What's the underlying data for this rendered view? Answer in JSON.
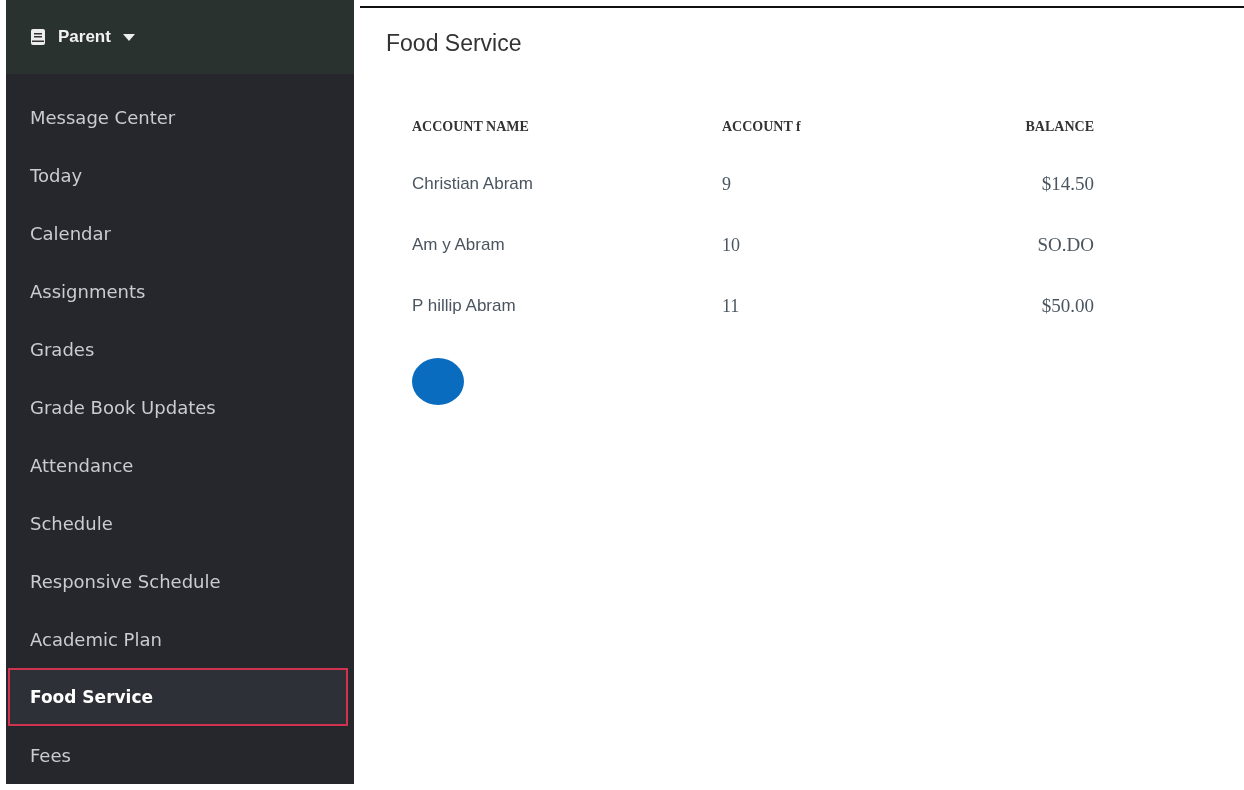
{
  "sidebar": {
    "header": {
      "label": "Parent"
    },
    "items": [
      {
        "label": "Message Center",
        "selected": false
      },
      {
        "label": "Today",
        "selected": false
      },
      {
        "label": "Calendar",
        "selected": false
      },
      {
        "label": "Assignments",
        "selected": false
      },
      {
        "label": "Grades",
        "selected": false
      },
      {
        "label": "Grade Book Updates",
        "selected": false
      },
      {
        "label": "Attendance",
        "selected": false
      },
      {
        "label": "Schedule",
        "selected": false
      },
      {
        "label": "Responsive Schedule",
        "selected": false
      },
      {
        "label": "Academic Plan",
        "selected": false
      },
      {
        "label": "Food Service",
        "selected": true
      },
      {
        "label": "Fees",
        "selected": false
      }
    ]
  },
  "main": {
    "title": "Food Service",
    "table": {
      "columns": [
        "ACCOUNT NAME",
        "ACCOUNT f",
        "BALANCE"
      ],
      "rows": [
        [
          "Christian Abram",
          "9",
          "$14.50"
        ],
        [
          "Am y Abram",
          "10",
          "SO.DO"
        ],
        [
          "P hillip Abram",
          "11",
          "$50.00"
        ]
      ]
    }
  }
}
